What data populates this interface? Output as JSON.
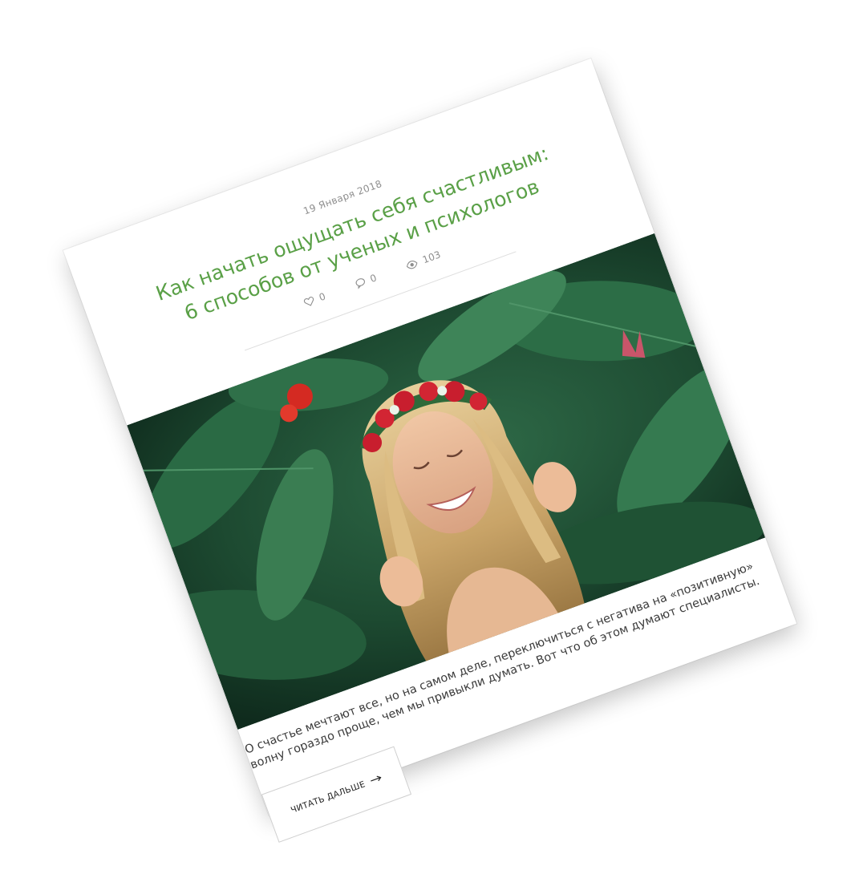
{
  "post": {
    "date": "19 Января 2018",
    "title": "Как начать ощущать себя счастливым: 6 способов от ученых и психологов",
    "likes": "0",
    "comments": "0",
    "views": "103",
    "excerpt": "О счастье мечтают все, но на самом деле, переключиться с негатива на «позитивную» волну гораздо проще, чем мы привыкли думать. Вот что об этом думают специалисты.",
    "read_more_label": "ЧИТАТЬ ДАЛЬШЕ"
  },
  "icons": {
    "likes": "heart-icon",
    "comments": "comment-icon",
    "views": "eye-icon",
    "read_more": "arrow-right-icon"
  },
  "colors": {
    "title": "#5aa047",
    "meta": "#8e8e8e",
    "text": "#3b3b3b"
  }
}
